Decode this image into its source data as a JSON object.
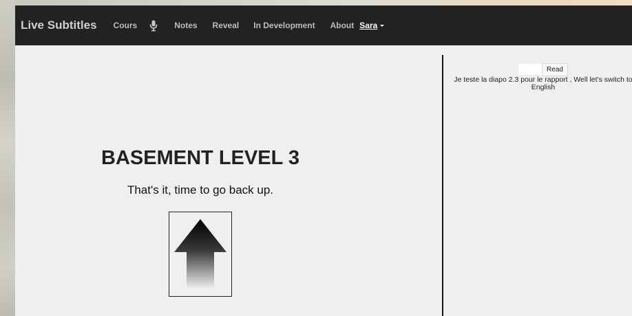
{
  "navbar": {
    "brand": "Live Subtitles",
    "items": [
      {
        "label": "Cours"
      },
      {
        "label": "Notes"
      },
      {
        "label": "Reveal"
      },
      {
        "label": "In Development"
      },
      {
        "label": "About"
      }
    ],
    "microphone_icon": "microphone-icon",
    "user": {
      "name": "Sara"
    }
  },
  "slide": {
    "title": "BASEMENT LEVEL 3",
    "subtitle": "That's it, time to go back up.",
    "image_icon": "up-arrow-icon"
  },
  "subtitles_panel": {
    "input_value": "",
    "read_button_label": "Read",
    "text": "Je teste la diapo 2.3 pour le rapport , Well let's switch to English"
  },
  "colors": {
    "navbar_background": "#222222",
    "page_background": "#efefef",
    "divider": "#111111"
  }
}
